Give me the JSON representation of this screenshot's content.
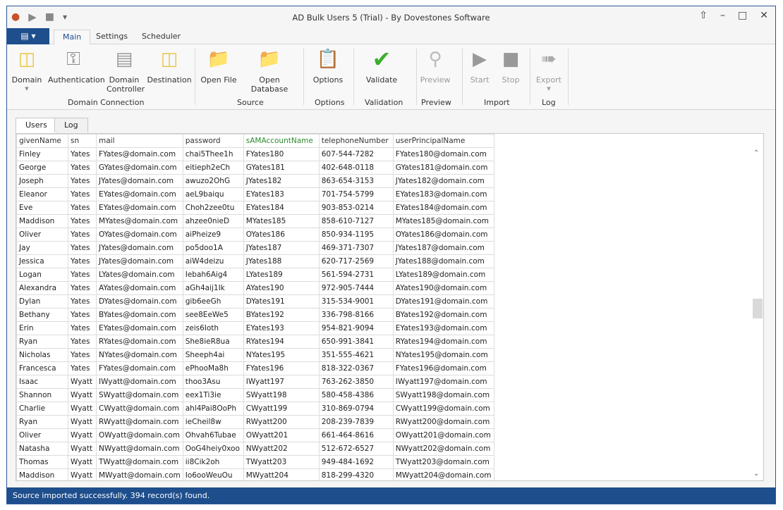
{
  "window": {
    "title": "AD Bulk Users 5 (Trial) - By Dovestones Software"
  },
  "qat": {
    "icons": [
      "app-users-icon",
      "play-icon",
      "stop-icon",
      "customize-qat-icon"
    ]
  },
  "ribbon_tabs": [
    "Main",
    "Settings",
    "Scheduler"
  ],
  "ribbon": {
    "buttons": [
      {
        "label": "Domain",
        "icon": "domain-tree-icon",
        "enabled": true
      },
      {
        "label": "Authentication",
        "icon": "key-icon",
        "enabled": true
      },
      {
        "label": "Domain Controller",
        "icon": "server-icon",
        "enabled": true
      },
      {
        "label": "Destination",
        "icon": "destination-tree-icon",
        "enabled": true
      },
      {
        "label": "Open File",
        "icon": "folder-file-icon",
        "enabled": true
      },
      {
        "label": "Open Database",
        "icon": "folder-database-icon",
        "enabled": true
      },
      {
        "label": "Options",
        "icon": "clipboard-icon",
        "enabled": true
      },
      {
        "label": "Validate",
        "icon": "checkmark-icon",
        "enabled": true
      },
      {
        "label": "Preview",
        "icon": "magnifier-icon",
        "enabled": false
      },
      {
        "label": "Start",
        "icon": "play-icon",
        "enabled": false
      },
      {
        "label": "Stop",
        "icon": "stop-icon",
        "enabled": false
      },
      {
        "label": "Export",
        "icon": "export-icon",
        "enabled": false
      }
    ],
    "groups": [
      "Domain Connection",
      "Source",
      "Options",
      "Validation",
      "Preview",
      "Import",
      "Log"
    ]
  },
  "content_tabs": [
    "Users",
    "Log"
  ],
  "table": {
    "columns": [
      "givenName",
      "sn",
      "mail",
      "password",
      "sAMAccountName",
      "telephoneNumber",
      "userPrincipalName"
    ],
    "rows": [
      [
        "Finley",
        "Yates",
        "FYates@domain.com",
        "chai5Thee1h",
        "FYates180",
        "607-544-7282",
        "FYates180@domain.com"
      ],
      [
        "George",
        "Yates",
        "GYates@domain.com",
        "eitieph2eCh",
        "GYates181",
        "402-648-0118",
        "GYates181@domain.com"
      ],
      [
        "Joseph",
        "Yates",
        "JYates@domain.com",
        "awuzo2OhG",
        "JYates182",
        "863-654-3153",
        "JYates182@domain.com"
      ],
      [
        "Eleanor",
        "Yates",
        "EYates@domain.com",
        "aeL9baiqu",
        "EYates183",
        "701-754-5799",
        "EYates183@domain.com"
      ],
      [
        "Eve",
        "Yates",
        "EYates@domain.com",
        "Choh2zee0tu",
        "EYates184",
        "903-853-0214",
        "EYates184@domain.com"
      ],
      [
        "Maddison",
        "Yates",
        "MYates@domain.com",
        "ahzee0nieD",
        "MYates185",
        "858-610-7127",
        "MYates185@domain.com"
      ],
      [
        "Oliver",
        "Yates",
        "OYates@domain.com",
        "aiPheize9",
        "OYates186",
        "850-934-1195",
        "OYates186@domain.com"
      ],
      [
        "Jay",
        "Yates",
        "JYates@domain.com",
        "po5doo1A",
        "JYates187",
        "469-371-7307",
        "JYates187@domain.com"
      ],
      [
        "Jessica",
        "Yates",
        "JYates@domain.com",
        "aiW4deizu",
        "JYates188",
        "620-717-2569",
        "JYates188@domain.com"
      ],
      [
        "Logan",
        "Yates",
        "LYates@domain.com",
        "Iebah6Aig4",
        "LYates189",
        "561-594-2731",
        "LYates189@domain.com"
      ],
      [
        "Alexandra",
        "Yates",
        "AYates@domain.com",
        "aGh4aij1Ik",
        "AYates190",
        "972-905-7444",
        "AYates190@domain.com"
      ],
      [
        "Dylan",
        "Yates",
        "DYates@domain.com",
        "gib6eeGh",
        "DYates191",
        "315-534-9001",
        "DYates191@domain.com"
      ],
      [
        "Bethany",
        "Yates",
        "BYates@domain.com",
        "see8EeWe5",
        "BYates192",
        "336-798-8166",
        "BYates192@domain.com"
      ],
      [
        "Erin",
        "Yates",
        "EYates@domain.com",
        "zeis6Ioth",
        "EYates193",
        "954-821-9094",
        "EYates193@domain.com"
      ],
      [
        "Ryan",
        "Yates",
        "RYates@domain.com",
        "She8ieR8ua",
        "RYates194",
        "650-991-3841",
        "RYates194@domain.com"
      ],
      [
        "Nicholas",
        "Yates",
        "NYates@domain.com",
        "Sheeph4ai",
        "NYates195",
        "351-555-4621",
        "NYates195@domain.com"
      ],
      [
        "Francesca",
        "Yates",
        "FYates@domain.com",
        "ePhooMa8h",
        "FYates196",
        "818-322-0367",
        "FYates196@domain.com"
      ],
      [
        "Isaac",
        "Wyatt",
        "IWyatt@domain.com",
        "thoo3Asu",
        "IWyatt197",
        "763-262-3850",
        "IWyatt197@domain.com"
      ],
      [
        "Shannon",
        "Wyatt",
        "SWyatt@domain.com",
        "eex1Ti3ie",
        "SWyatt198",
        "580-458-4386",
        "SWyatt198@domain.com"
      ],
      [
        "Charlie",
        "Wyatt",
        "CWyatt@domain.com",
        "ahl4Pai8OoPh",
        "CWyatt199",
        "310-869-0794",
        "CWyatt199@domain.com"
      ],
      [
        "Ryan",
        "Wyatt",
        "RWyatt@domain.com",
        "ieCheil8w",
        "RWyatt200",
        "208-239-7839",
        "RWyatt200@domain.com"
      ],
      [
        "Oliver",
        "Wyatt",
        "OWyatt@domain.com",
        "Ohvah6Tubae",
        "OWyatt201",
        "661-464-8616",
        "OWyatt201@domain.com"
      ],
      [
        "Natasha",
        "Wyatt",
        "NWyatt@domain.com",
        "OoG4heiy0xoo",
        "NWyatt202",
        "512-672-6527",
        "NWyatt202@domain.com"
      ],
      [
        "Thomas",
        "Wyatt",
        "TWyatt@domain.com",
        "ii8Cik2oh",
        "TWyatt203",
        "949-484-1692",
        "TWyatt203@domain.com"
      ],
      [
        "Maddison",
        "Wyatt",
        "MWyatt@domain.com",
        "Io6ooWeuOu",
        "MWyatt204",
        "818-299-4320",
        "MWyatt204@domain.com"
      ]
    ]
  },
  "status": {
    "text": "Source imported successfully. 394 record(s) found."
  },
  "colors": {
    "accent": "#1e4e8c",
    "highlight_column": "#2e8b2e"
  }
}
